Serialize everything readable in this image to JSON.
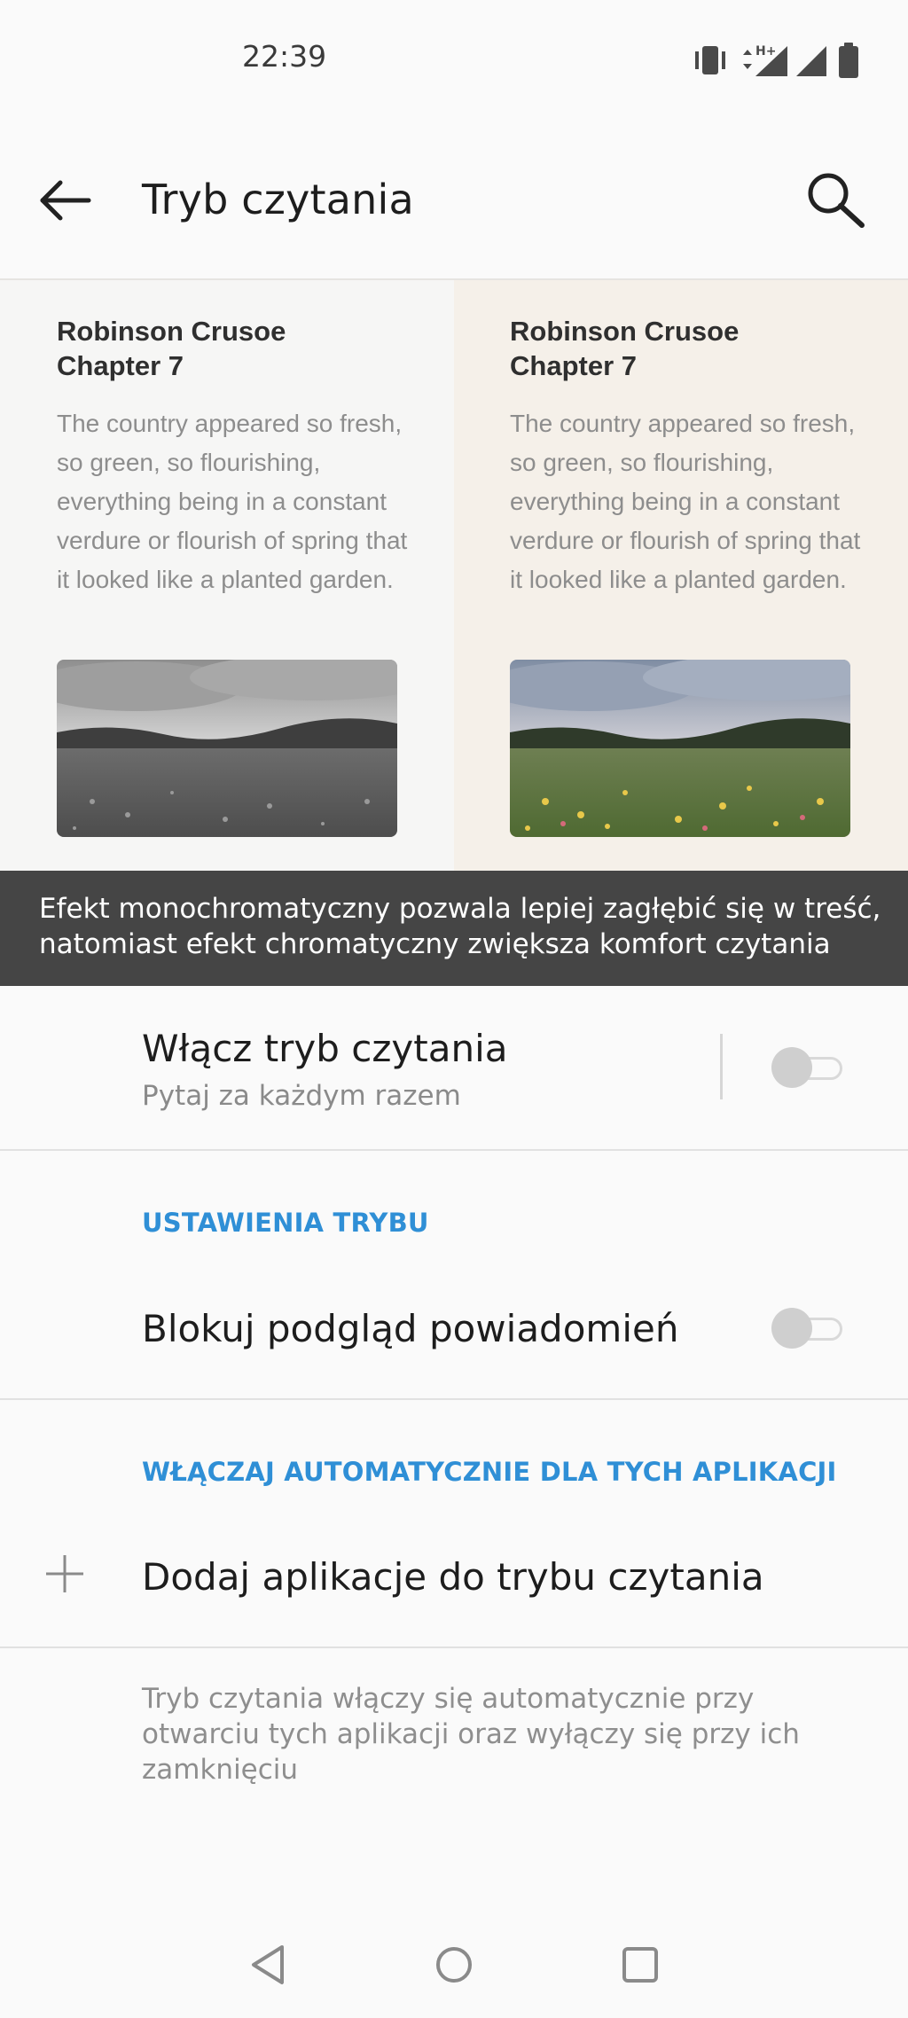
{
  "status_bar": {
    "time": "22:39",
    "icons": [
      "vibrate-icon",
      "data-arrows-icon",
      "signal-hplus-icon",
      "signal-icon",
      "battery-icon"
    ],
    "network_label": "H+"
  },
  "toolbar": {
    "title": "Tryb czytania",
    "back_icon": "arrow-left-icon",
    "search_icon": "search-icon"
  },
  "preview": {
    "left": {
      "title_line1": "Robinson Crusoe",
      "title_line2": "Chapter 7",
      "text": "The country appeared so fresh, so green, so flourishing, everything being in a constant verdure or flourish of spring that it looked like a planted garden.",
      "image_style": "monochrome"
    },
    "right": {
      "title_line1": "Robinson Crusoe",
      "title_line2": "Chapter 7",
      "text": "The country appeared so fresh, so green, so flourishing, everything being in a constant verdure or flourish of spring that it looked like a planted garden.",
      "image_style": "chromatic"
    }
  },
  "banner": {
    "text": "Efekt monochromatyczny pozwala lepiej zagłębić się w treść, natomiast efekt chromatyczny zwiększa komfort czytania"
  },
  "reading_mode": {
    "title": "Włącz tryb czytania",
    "subtitle": "Pytaj za każdym razem",
    "enabled": false
  },
  "mode_settings": {
    "section_label": "USTAWIENIA TRYBU",
    "block_notifications_label": "Blokuj podgląd powiadomień",
    "block_notifications_enabled": false
  },
  "auto_apps": {
    "section_label": "WŁĄCZAJ AUTOMATYCZNIE DLA TYCH APLIKACJI",
    "add_label": "Dodaj aplikacje do trybu czytania",
    "add_icon": "plus-icon",
    "footnote": "Tryb czytania włączy się automatycznie przy otwarciu tych aplikacji oraz wyłączy się przy ich zamknięciu"
  },
  "nav_bar": {
    "buttons": [
      "back-triangle-icon",
      "home-circle-icon",
      "recents-square-icon"
    ]
  },
  "colors": {
    "accent": "#2f8fd6",
    "banner_bg": "#454545",
    "background": "#fafafa"
  }
}
